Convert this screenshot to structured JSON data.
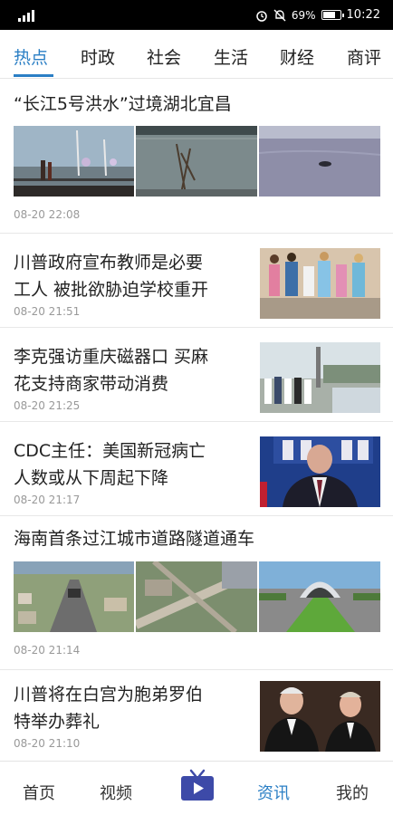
{
  "status_bar": {
    "battery": "69%",
    "time": "10:22",
    "battery_level": 0.69
  },
  "tabs": [
    {
      "label": "热点",
      "active": true
    },
    {
      "label": "时政"
    },
    {
      "label": "社会"
    },
    {
      "label": "生活"
    },
    {
      "label": "财经"
    },
    {
      "label": "商评"
    }
  ],
  "feed": {
    "items": [
      {
        "title": "“长江5号洪水”过境湖北宜昌",
        "time": "08-20 22:08"
      },
      {
        "title_line1": "川普政府宣布教师是必要",
        "title_line2": "工人 被批欲胁迫学校重开",
        "time": "08-20 21:51"
      },
      {
        "title_line1": "李克强访重庆磁器口 买麻",
        "title_line2": "花支持商家带动消费",
        "time": "08-20 21:25"
      },
      {
        "title_line1": "CDC主任：美国新冠病亡",
        "title_line2": "人数或从下周起下降",
        "time": "08-20 21:17"
      },
      {
        "title": "海南首条过江城市道路隧道通车",
        "time": "08-20 21:14"
      },
      {
        "title_line1": "川普将在白宫为胞弟罗伯",
        "title_line2": "特举办葬礼",
        "time": "08-20 21:10"
      }
    ]
  },
  "bottom_nav": {
    "home": "首页",
    "video": "视频",
    "news": "资讯",
    "mine": "我的",
    "tv_icon": "tv-icon"
  },
  "colors": {
    "accent": "#2b7fc5",
    "tv": "#3d4aa8"
  }
}
